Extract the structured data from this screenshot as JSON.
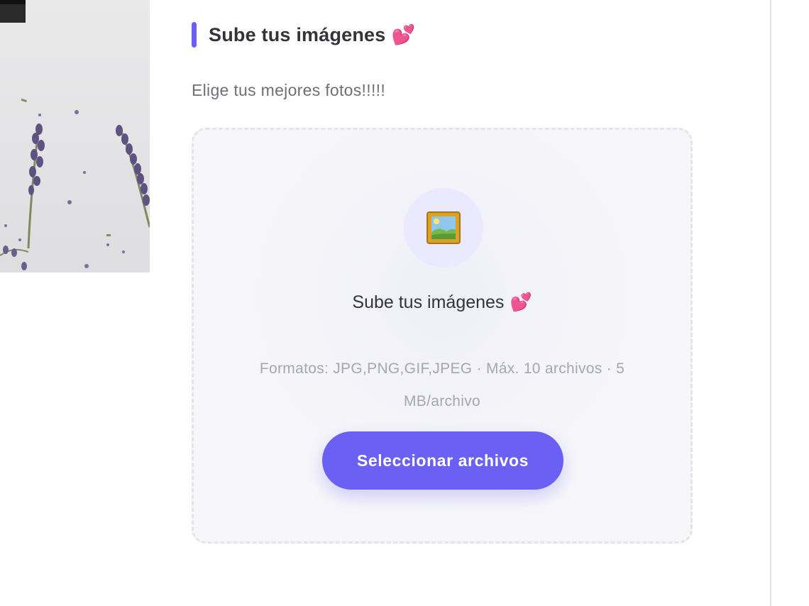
{
  "section": {
    "title": "Sube tus imágenes",
    "emoji": "💕",
    "subtitle": "Elige tus mejores fotos!!!!!"
  },
  "upload": {
    "title": "Sube tus imágenes",
    "emoji": "💕",
    "icon": "framed-picture-icon",
    "formats": "Formatos: JPG,PNG,GIF,JPEG · Máx. 10 archivos · 5 MB/archivo",
    "button_label": "Seleccionar archivos"
  },
  "colors": {
    "accent": "#6b60f4",
    "icon_circle": "#ebe9fd",
    "heading_text": "#33343a",
    "muted_text": "#a4a7b1"
  }
}
